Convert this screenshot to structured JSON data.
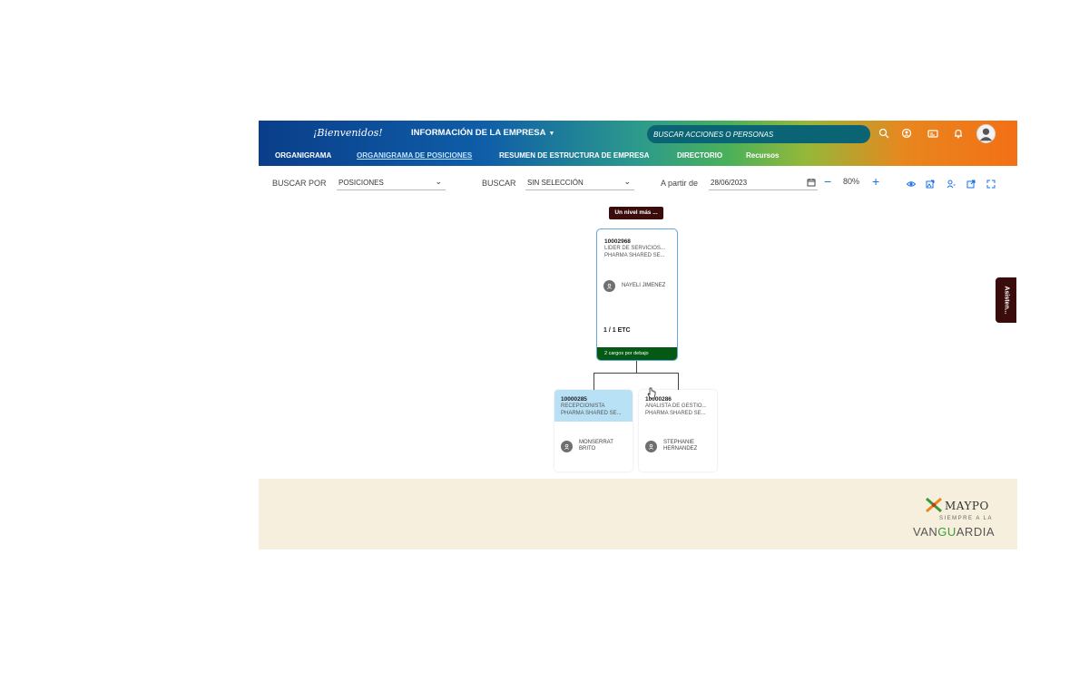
{
  "header": {
    "brand": "¡Bienvenidos!",
    "company_menu": "INFORMACIÓN DE LA EMPRESA",
    "search_placeholder": "BUSCAR ACCIONES O PERSONAS",
    "icons": [
      "search-icon",
      "people-icon",
      "badge-icon",
      "bell-icon",
      "user-avatar"
    ]
  },
  "nav": {
    "items": [
      "ORGANIGRAMA",
      "ORGANIGRAMA DE POSICIONES",
      "RESUMEN DE ESTRUCTURA DE EMPRESA",
      "DIRECTORIO",
      "Recursos"
    ],
    "active": "ORGANIGRAMA DE POSICIONES"
  },
  "toolbar": {
    "search_by_label": "BUSCAR POR",
    "search_by_value": "POSICIONES",
    "search_label": "BUSCAR",
    "search_value": "SIN SELECCIÓN",
    "date_label": "A partir de",
    "date_value": "28/06/2023",
    "zoom": "80%"
  },
  "org": {
    "level_button": "Un nivel más ...",
    "main": {
      "code": "10002968",
      "title": "LIDER DE SERVICIOS...",
      "department": "PHARMA SHARED SE...",
      "person": "NAYELI JIMENEZ",
      "etc": "1 / 1 ETC",
      "below": "2 cargos por debajo"
    },
    "children": [
      {
        "code": "10000285",
        "title": "RECEPCIONISTA",
        "department": "PHARMA SHARED SE...",
        "person_line1": "MONSERRAT",
        "person_line2": "BRITO"
      },
      {
        "code": "10000286",
        "title": "ANALISTA DE GESTIO...",
        "department": "PHARMA SHARED SE...",
        "person_line1": "STEPHANIE",
        "person_line2": "HERNANDEZ"
      }
    ],
    "side_tab": "Asisten..."
  },
  "footer": {
    "logo_name": "MAYPO",
    "logo_tagline": "SIEMPRE A LA",
    "logo_word_a": "VAN",
    "logo_word_b": "GU",
    "logo_word_c": "ARDIA"
  },
  "colors": {
    "nav_active": "#bfe3ff",
    "accent_blue": "#1a73e8",
    "dark_badge": "#3a0c0c",
    "card_border": "#62a8d8",
    "below_bar": "#045a14",
    "selected_child": "#b9e1f6",
    "footer_bg": "#f7efde"
  }
}
